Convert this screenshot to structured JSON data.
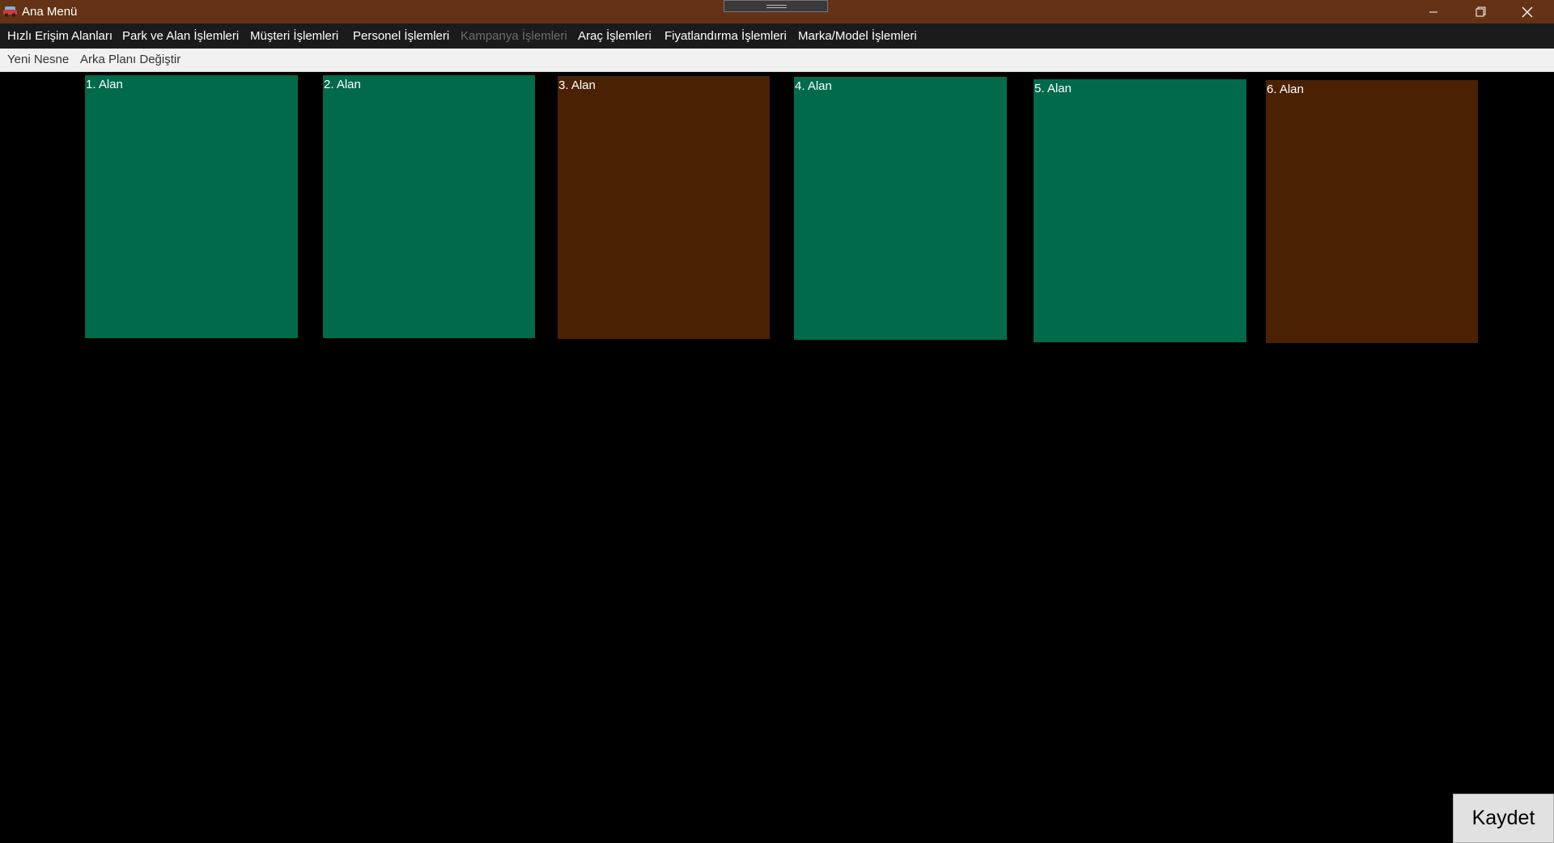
{
  "window": {
    "title": "Ana Menü",
    "app_icon": "car-icon",
    "controls": [
      "minimize-icon",
      "restore-icon",
      "close-icon"
    ]
  },
  "menu": {
    "items": [
      {
        "label": "Hızlı Erişim Alanları",
        "enabled": true
      },
      {
        "label": "Park ve Alan İşlemleri",
        "enabled": true
      },
      {
        "label": "Müşteri İşlemleri",
        "enabled": true
      },
      {
        "label": "Personel İşlemleri",
        "enabled": true
      },
      {
        "label": "Kampanya İşlemleri",
        "enabled": false
      },
      {
        "label": "Araç İşlemleri",
        "enabled": true
      },
      {
        "label": "Fiyatlandırma İşlemleri",
        "enabled": true
      },
      {
        "label": "Marka/Model İşlemleri",
        "enabled": true
      }
    ]
  },
  "toolbar": {
    "items": [
      {
        "label": "Yeni Nesne"
      },
      {
        "label": "Arka Planı Değiştir"
      }
    ]
  },
  "areas": [
    {
      "label": "1. Alan",
      "color": "#006a4b"
    },
    {
      "label": "2. Alan",
      "color": "#006a4b"
    },
    {
      "label": "3. Alan",
      "color": "#4a2203"
    },
    {
      "label": "4. Alan",
      "color": "#006a4b"
    },
    {
      "label": "5. Alan",
      "color": "#006a4b"
    },
    {
      "label": "6. Alan",
      "color": "#4a2203"
    }
  ],
  "save_button": {
    "label": "Kaydet"
  },
  "colors": {
    "titlebar": "#643315",
    "menubar": "#1b1b1b",
    "available_area": "#006a4b",
    "occupied_area": "#4a2203"
  }
}
